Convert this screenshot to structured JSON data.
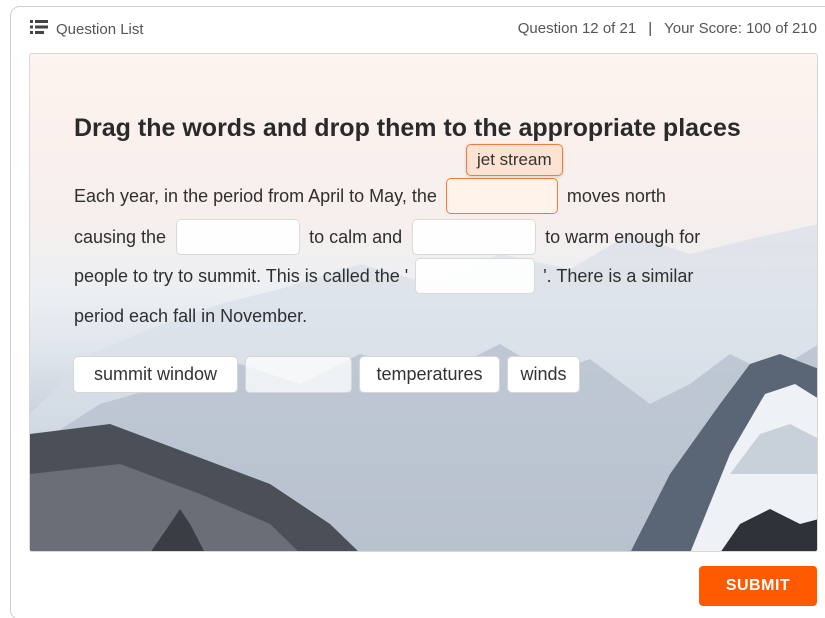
{
  "header": {
    "question_list_label": "Question List",
    "question_progress": "Question 12 of 21",
    "separator": "|",
    "score": "Your Score: 100 of 210"
  },
  "question": {
    "title": "Drag the words and drop them to the appropriate places",
    "line1_a": "Each year, in the period from April to May, the",
    "line1_b": "moves north",
    "line2_a": "causing the",
    "line2_b": "to calm and",
    "line2_c": "to warm enough for",
    "line3_a": "people to try to summit. This is called the '",
    "line3_b": "'. There is a similar",
    "line4": "period each fall in November."
  },
  "dragging_word": "jet stream",
  "word_bank": [
    "summit window",
    "",
    "temperatures",
    "winds"
  ],
  "submit_label": "SUBMIT",
  "colors": {
    "accent": "#ff5a00",
    "drag_border": "#f47a3c",
    "drag_fill": "#fde3d1"
  }
}
